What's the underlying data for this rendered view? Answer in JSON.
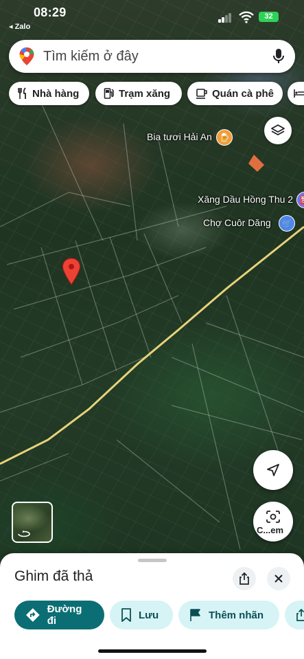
{
  "status_bar": {
    "time": "08:29",
    "back_app": "◂ Zalo",
    "battery": "32"
  },
  "search": {
    "placeholder": "Tìm kiếm ở đây"
  },
  "categories": [
    {
      "label": "Nhà hàng",
      "icon": "fork-knife-icon"
    },
    {
      "label": "Trạm xăng",
      "icon": "gas-pump-icon"
    },
    {
      "label": "Quán cà phê",
      "icon": "coffee-cup-icon"
    },
    {
      "label": "",
      "icon": "bed-icon"
    }
  ],
  "map_labels": {
    "bia_tuoi": "Bia tươi Hải An",
    "xang_dau": "Xăng Dầu Hồng Thu 2",
    "cho": "Chợ Cuôr Dăng"
  },
  "camera_button": {
    "label": "C...em"
  },
  "place_sheet": {
    "title": "Ghim đã thả",
    "actions": [
      {
        "label": "Đường đi",
        "icon": "directions-icon"
      },
      {
        "label": "Lưu",
        "icon": "bookmark-icon"
      },
      {
        "label": "Thêm nhãn",
        "icon": "flag-icon"
      }
    ]
  },
  "colors": {
    "primary_action": "#0b6e74",
    "secondary_action": "#d6f3f5",
    "pin_red": "#ea4335",
    "poi_orange": "#f29d39",
    "poi_blue": "#4f86ec",
    "poi_purple": "#7b6ee8"
  }
}
